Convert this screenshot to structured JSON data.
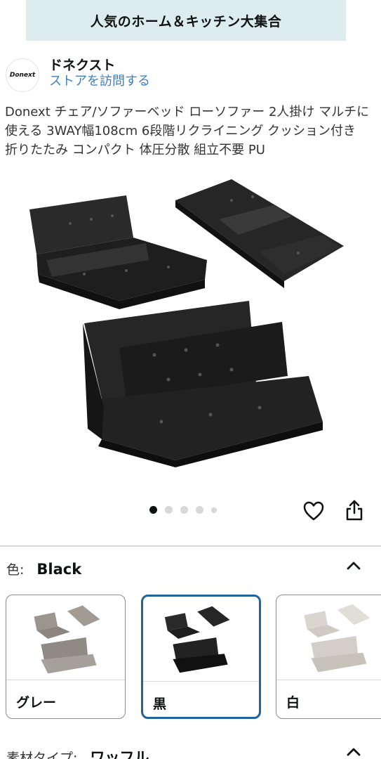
{
  "banner": {
    "text": "人気のホーム＆キッチン大集合"
  },
  "store": {
    "logo_text": "Donext",
    "name": "ドネクスト",
    "visit_link": "ストアを訪問する"
  },
  "product": {
    "title": "Donext チェア/ソファーベッド ローソファー 2人掛け マルチに使える 3WAY幅108cm 6段階リクライニング クッション付き 折りたたみ コンパクト 体圧分散 組立不要 PU"
  },
  "image_carousel": {
    "total": 5,
    "active_index": 0
  },
  "icons": {
    "like": "heart-icon",
    "share": "share-icon",
    "collapse": "chevron-up-icon"
  },
  "color_selector": {
    "label": "色:",
    "selected": "Black",
    "options": [
      {
        "label": "グレー"
      },
      {
        "label": "黒"
      },
      {
        "label": "白"
      }
    ]
  },
  "material_selector": {
    "label": "素材タイプ:",
    "selected": "ワッフル"
  },
  "colors": {
    "banner_bg": "#dcecef",
    "link": "#3f7fbf",
    "selected_border": "#2162a1"
  }
}
